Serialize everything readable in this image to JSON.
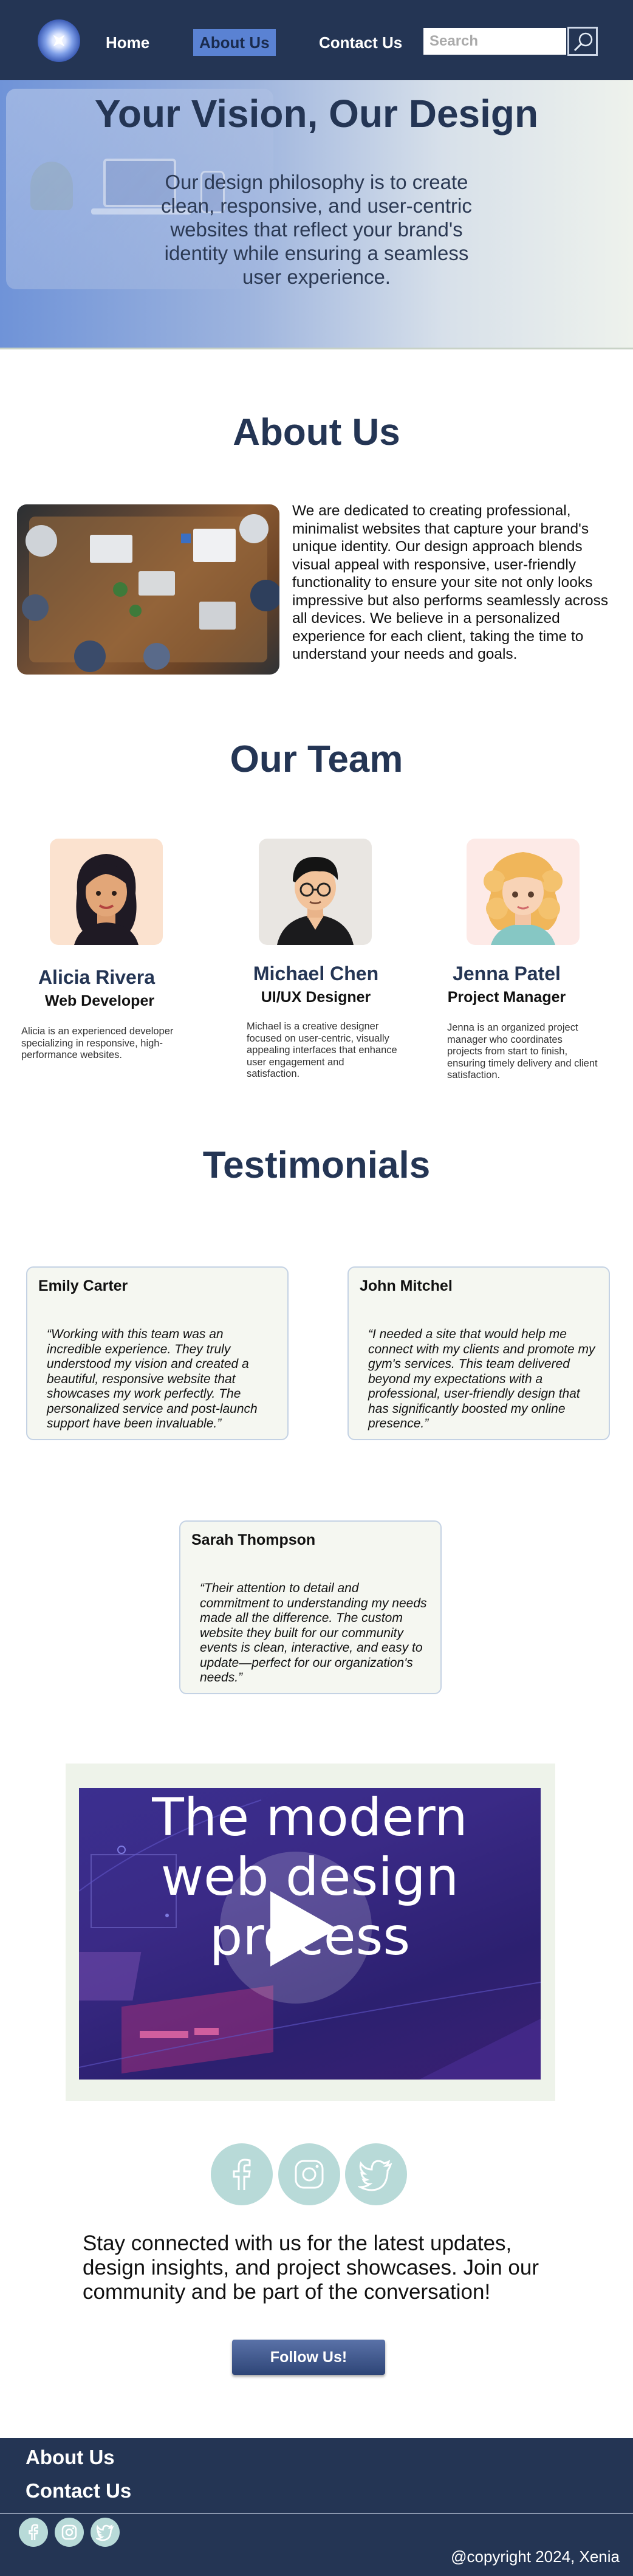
{
  "nav": {
    "home": "Home",
    "about": "About Us",
    "contact": "Contact Us",
    "search_placeholder": "Search"
  },
  "hero": {
    "title": "Your Vision, Our Design",
    "text": "Our design philosophy is to create clean, responsive, and user-centric websites that reflect your brand's identity while ensuring a seamless user experience."
  },
  "about": {
    "title": "About Us",
    "text": "We are dedicated to creating professional, minimalist websites that capture your brand's unique identity. Our design approach blends visual appeal with responsive, user-friendly functionality to ensure your site not only looks impressive but also performs seamlessly across all devices. We believe in a personalized experience for each client, taking the time to understand your needs and goals."
  },
  "team": {
    "title": "Our Team",
    "members": [
      {
        "name": "Alicia Rivera",
        "role": "Web Developer",
        "desc": "Alicia is an experienced developer specializing in responsive, high-performance websites."
      },
      {
        "name": "Michael Chen",
        "role": "UI/UX Designer",
        "desc": "Michael is a creative designer focused on user-centric, visually appealing interfaces that enhance user engagement and satisfaction."
      },
      {
        "name": "Jenna Patel",
        "role": "Project Manager",
        "desc": "Jenna is an organized project manager who coordinates projects from start to finish, ensuring timely delivery and client satisfaction."
      }
    ]
  },
  "testimonials": {
    "title": "Testimonials",
    "items": [
      {
        "name": "Emily Carter",
        "quote": "“Working with this team was an incredible experience. They truly understood my vision and created a beautiful, responsive website that showcases my work perfectly. The personalized service and post-launch support have been invaluable.”"
      },
      {
        "name": "John Mitchel",
        "quote": "“I needed a site that would help me connect with my clients and promote my gym's services. This team delivered beyond my expectations with a professional, user-friendly design that has significantly boosted my online presence.”"
      },
      {
        "name": "Sarah Thompson",
        "quote": "“Their attention to detail and commitment to understanding my needs made all the difference. The custom website they built for our community events is clean, interactive, and easy to update—perfect for our organization's needs.”"
      }
    ]
  },
  "video": {
    "line1": "The modern",
    "line2": "web design",
    "line3": "process"
  },
  "social": {
    "icons": [
      "facebook-icon",
      "instagram-icon",
      "twitter-icon"
    ],
    "text": "Stay connected with us for the latest updates, design insights, and project showcases. Join our community and be part of the conversation!",
    "button": "Follow Us!"
  },
  "footer": {
    "about": "About Us",
    "contact": "Contact Us",
    "copyright": "@copyright 2024, Xenia"
  },
  "colors": {
    "navy": "#243554",
    "accent": "#5a82d3",
    "social": "#b8dad8",
    "card": "#f5f7f1"
  }
}
